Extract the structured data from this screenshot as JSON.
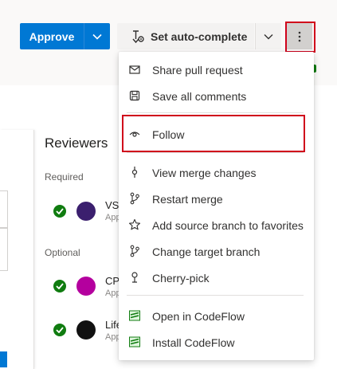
{
  "toolbar": {
    "approve_label": "Approve",
    "auto_complete_label": "Set auto-complete"
  },
  "reviewers": {
    "title": "Reviewers",
    "required_label": "Required",
    "optional_label": "Optional",
    "items": [
      {
        "name": "VS",
        "status": "Appr",
        "avatar_color": "#3b1f6e"
      },
      {
        "name": "CP",
        "status": "Appr",
        "avatar_color": "#b4009e"
      },
      {
        "name": "Life",
        "status": "Appr",
        "avatar_color": "#111111"
      }
    ]
  },
  "menu": {
    "items": [
      {
        "label": "Share pull request",
        "icon": "mail-icon"
      },
      {
        "label": "Save all comments",
        "icon": "save-icon"
      },
      {
        "label": "Follow",
        "icon": "eye-icon"
      },
      {
        "label": "View merge changes",
        "icon": "commit-icon"
      },
      {
        "label": "Restart merge",
        "icon": "branch-icon"
      },
      {
        "label": "Add source branch to favorites",
        "icon": "star-icon"
      },
      {
        "label": "Change target branch",
        "icon": "branch-icon"
      },
      {
        "label": "Cherry-pick",
        "icon": "cherry-pick-icon"
      },
      {
        "label": "Open in CodeFlow",
        "icon": "codeflow-icon"
      },
      {
        "label": "Install CodeFlow",
        "icon": "codeflow-icon"
      }
    ]
  },
  "colors": {
    "accent": "#0078d4",
    "highlight": "#d0021b",
    "success": "#107c10"
  }
}
